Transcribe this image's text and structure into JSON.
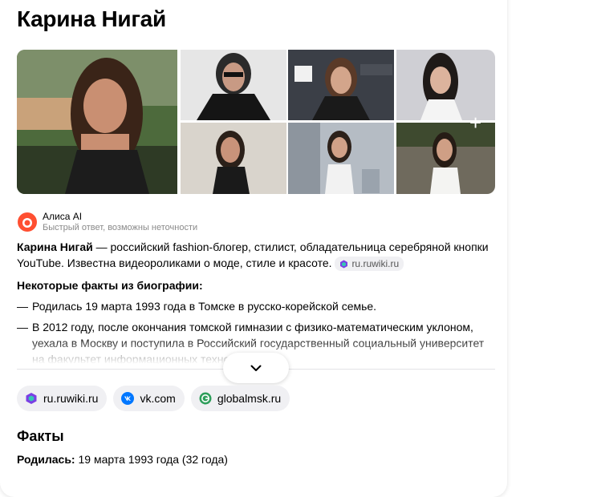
{
  "entity": {
    "name": "Карина Нигай"
  },
  "gallery": {
    "photos": [
      {
        "alt": "photo-1"
      },
      {
        "alt": "photo-2"
      },
      {
        "alt": "photo-3"
      },
      {
        "alt": "photo-4"
      },
      {
        "alt": "photo-5"
      },
      {
        "alt": "photo-6"
      },
      {
        "alt": "photo-7"
      }
    ],
    "more_label": "+"
  },
  "alice": {
    "name": "Алиса AI",
    "subtitle": "Быстрый ответ, возможны неточности"
  },
  "summary": {
    "name_bold": "Карина Нигай",
    "text": " — российский fashion-блогер, стилист, обладательница серебряной кнопки YouTube. Известна видеороликами о моде, стиле и красоте.",
    "source_chip": "ru.ruwiki.ru"
  },
  "bio": {
    "heading": "Некоторые факты из биографии:",
    "items": [
      "Родилась 19 марта 1993 года в Томске в русско-корейской семье.",
      "В 2012 году, после окончания томской гимназии с физико-математическим уклоном, уехала в Москву и поступила в Российский государственный социальный университет на факультет информационных технологий"
    ]
  },
  "sources": [
    {
      "label": "ru.ruwiki.ru",
      "icon": "ruwiki-icon",
      "color": "#7b3fe4"
    },
    {
      "label": "vk.com",
      "icon": "vk-icon",
      "color": "#0077ff"
    },
    {
      "label": "globalmsk.ru",
      "icon": "globalmsk-icon",
      "color": "#2e9e5b"
    }
  ],
  "facts": {
    "title": "Факты",
    "born_label": "Родилась:",
    "born_value": " 19 марта 1993 года (32 года)"
  },
  "colors": {
    "alice_accent": "#ff4f31",
    "chip_bg": "#f0f0f3",
    "muted_text": "#8a8a8a"
  }
}
